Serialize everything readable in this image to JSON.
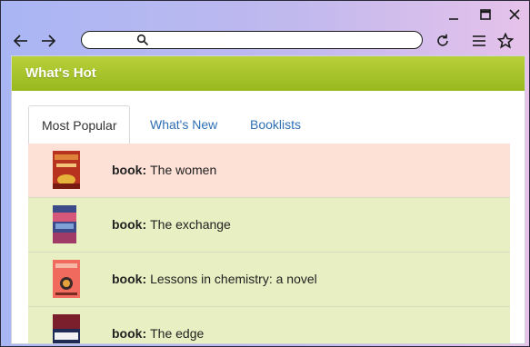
{
  "browser": {
    "url": "",
    "icons": {
      "back": "back-arrow-icon",
      "forward": "forward-arrow-icon",
      "search": "search-icon",
      "reload": "reload-icon",
      "menu": "hamburger-menu-icon",
      "bookmark": "star-icon",
      "minimize": "minimize-icon",
      "maximize": "maximize-icon",
      "close": "close-icon"
    }
  },
  "widget": {
    "title": "What's Hot",
    "accent_color": "#a8c52a",
    "tabs": [
      {
        "label": "Most Popular",
        "active": true
      },
      {
        "label": "What's New",
        "active": false
      },
      {
        "label": "Booklists",
        "active": false
      }
    ],
    "items": [
      {
        "type_label": "book:",
        "title": "The women",
        "bg": "#fde0d6"
      },
      {
        "type_label": "book:",
        "title": "The exchange",
        "bg": "#e8efc2"
      },
      {
        "type_label": "book:",
        "title": "Lessons in chemistry: a novel",
        "bg": "#e8efc2"
      },
      {
        "type_label": "book:",
        "title": "The edge",
        "bg": "#e8efc2"
      }
    ]
  }
}
